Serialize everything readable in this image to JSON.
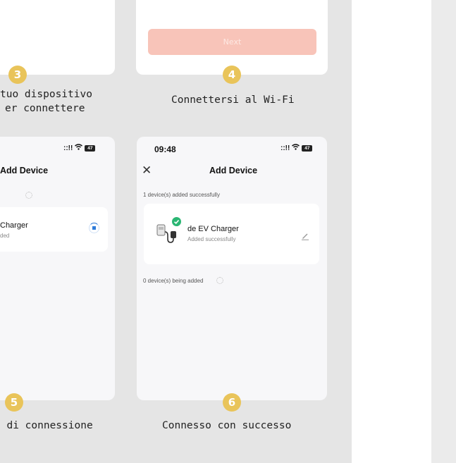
{
  "steps": {
    "s3": {
      "number": "3",
      "caption_line1": "tuo dispositivo",
      "caption_line2": "er connettere"
    },
    "s4": {
      "number": "4",
      "caption": "Connettersi al Wi-Fi",
      "next_label": "Next"
    },
    "s5": {
      "number": "5",
      "caption": "n di connessione",
      "screen": {
        "title": "Add Device",
        "device_name": "Charger",
        "device_sub": "ded"
      }
    },
    "s6": {
      "number": "6",
      "caption": "Connesso con successo",
      "screen": {
        "time": "09:48",
        "title": "Add Device",
        "added_count": "1 device(s) added successfully",
        "device_name": "de EV Charger",
        "device_sub": "Added successfully",
        "being_added": "0 device(s) being added"
      }
    }
  },
  "status_bar": {
    "signal": "::!!",
    "wifi": "ᯤ",
    "battery": "47"
  },
  "colors": {
    "badge": "#e9c45a",
    "next_button": "#f8c4b9",
    "success": "#2bb673",
    "progress": "#2f7cd9"
  },
  "icons": [
    "close-icon",
    "wifi-icon",
    "signal-icon",
    "battery-icon",
    "check-icon",
    "edit-icon",
    "spinner-icon",
    "ev-charger-icon"
  ]
}
